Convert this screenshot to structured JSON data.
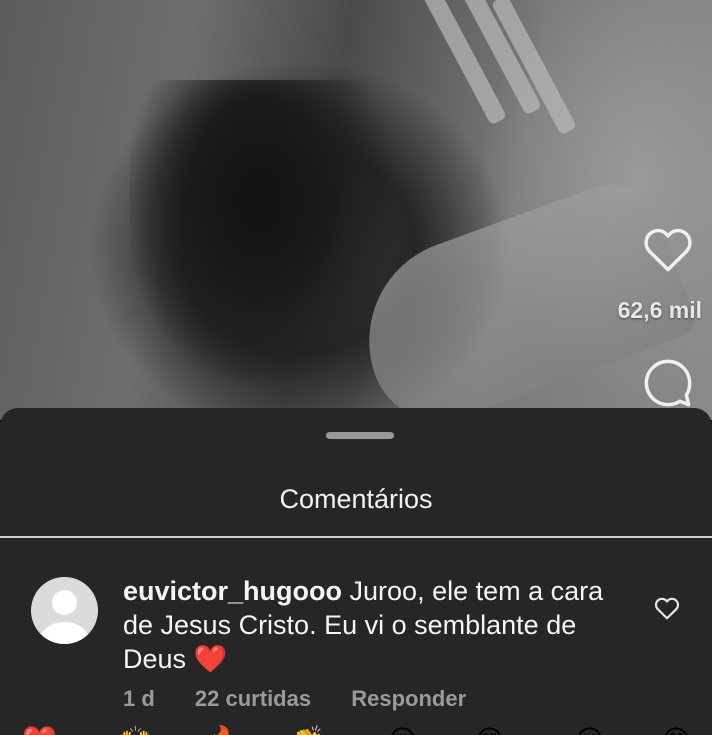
{
  "video": {
    "like_count": "62,6 mil",
    "icons": {
      "like": "heart-outline-icon",
      "comment": "speech-bubble-icon"
    }
  },
  "sheet": {
    "title": "Comentários"
  },
  "comment": {
    "username": "euvictor_hugooo",
    "text": "Juroo, ele tem a cara de Jesus Cristo. Eu vi o semblante de Deus",
    "emoji": "❤️",
    "time": "1 d",
    "likes": "22 curtidas",
    "reply": "Responder"
  },
  "quick_reactions": [
    "❤️",
    "🙌",
    "🔥",
    "👏",
    "😢",
    "😍",
    "😮",
    "😂"
  ],
  "colors": {
    "sheet_bg": "#262626",
    "text_primary": "#f5f5f5",
    "text_secondary": "#9a9a9a",
    "heart": "#e0202e"
  }
}
